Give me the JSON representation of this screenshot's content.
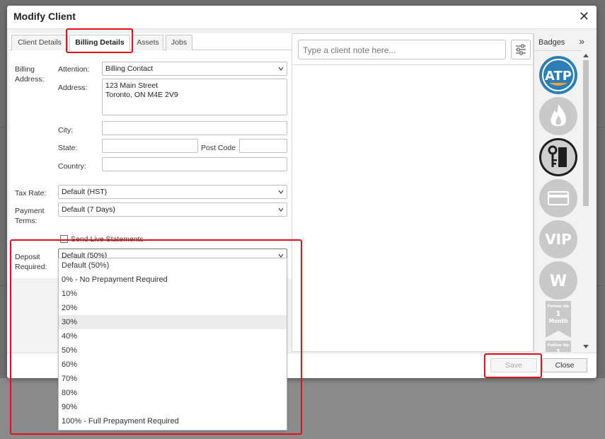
{
  "modal": {
    "title": "Modify Client"
  },
  "tabs": [
    "Client Details",
    "Billing Details",
    "Assets",
    "Jobs"
  ],
  "billing": {
    "section_label": "Billing\nAddress:",
    "attention_label": "Attention:",
    "attention_value": "Billing Contact",
    "address_label": "Address:",
    "address_value": "123 Main Street\nToronto, ON M4E 2V9",
    "city_label": "City:",
    "city_value": "",
    "state_label": "State:",
    "state_value": "",
    "postcode_label": "Post Code",
    "postcode_value": "",
    "country_label": "Country:",
    "country_value": ""
  },
  "tax": {
    "label": "Tax Rate:",
    "value": "Default (HST)"
  },
  "payment": {
    "label": "Payment\nTerms:",
    "value": "Default (7 Days)"
  },
  "statements": {
    "label": "Send Live Statements",
    "checked": false
  },
  "deposit": {
    "label": "Deposit\nRequired:",
    "value": "Default (50%)",
    "options": [
      "Default (50%)",
      "0% - No Prepayment Required",
      "10%",
      "20%",
      "30%",
      "40%",
      "50%",
      "60%",
      "70%",
      "80%",
      "90%",
      "100% - Full Prepayment Required"
    ],
    "hovered_option": "30%"
  },
  "notes": {
    "placeholder": "Type a client note here..."
  },
  "badges": {
    "title": "Badges",
    "toggle_icon": "»",
    "items": [
      {
        "icon": "atp-badge",
        "text": "ATP"
      },
      {
        "icon": "flame-badge",
        "text": ""
      },
      {
        "icon": "thermostat-key-badge",
        "text": ""
      },
      {
        "icon": "credit-card-badge",
        "text": ""
      },
      {
        "icon": "vip-badge",
        "text": "VIP"
      },
      {
        "icon": "w-badge",
        "text": "W"
      },
      {
        "icon": "follow-up-badge",
        "lines": [
          "Follow Up",
          "1",
          "Month"
        ]
      },
      {
        "icon": "follow-up-badge",
        "lines": [
          "Follow Up",
          "1"
        ]
      }
    ]
  },
  "footer": {
    "save_label": "Save",
    "close_label": "Close"
  },
  "colors": {
    "highlight": "#e0111b",
    "atp_blue": "#2b7fb6",
    "atp_orange": "#f2a23a",
    "badge_gray": "#c9c9c9"
  }
}
